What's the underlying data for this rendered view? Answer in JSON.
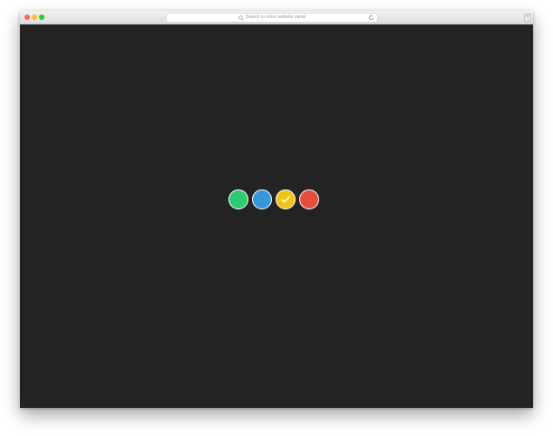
{
  "browser": {
    "address_placeholder": "Search or enter website name",
    "traffic_lights": {
      "close": "#ff5f57",
      "minimize": "#febc2e",
      "zoom": "#28c840"
    },
    "reload_icon": "reload-icon",
    "sidebar_icon": "plus-icon"
  },
  "page": {
    "background": "#232323"
  },
  "color_options": [
    {
      "name": "green",
      "color": "#2ecc71",
      "selected": false
    },
    {
      "name": "blue",
      "color": "#3498db",
      "selected": false
    },
    {
      "name": "yellow",
      "color": "#f1c40f",
      "selected": true
    },
    {
      "name": "red",
      "color": "#e74c3c",
      "selected": false
    }
  ]
}
